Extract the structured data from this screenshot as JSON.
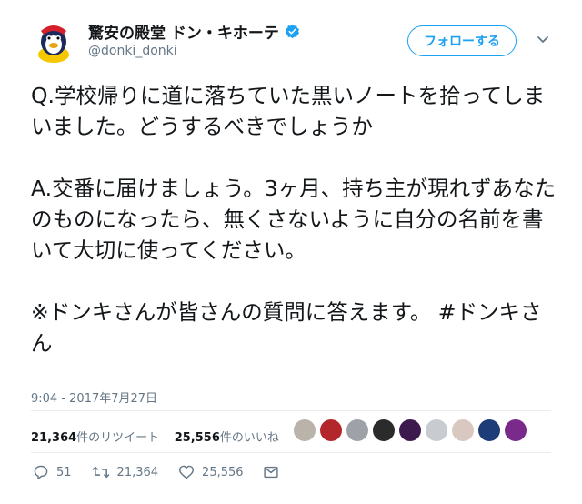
{
  "profile": {
    "display_name": "驚安の殿堂 ドン・キホーテ",
    "handle": "@donki_donki"
  },
  "follow_button": {
    "label": "フォローする"
  },
  "tweet": {
    "text": "Q.学校帰りに道に落ちていた黒いノートを拾ってしまいました。どうするべきでしょうか\n\nA.交番に届けましょう。3ヶ月、持ち主が現れずあなたのものになったら、無くさないように自分の名前を書いて大切に使ってください。\n\n※ドンキさんが皆さんの質問に答えます。 #ドンキさん",
    "timestamp": "9:04 - 2017年7月27日"
  },
  "stats": {
    "retweets_count": "21,364",
    "retweets_label": "件のリツイート",
    "likes_count": "25,556",
    "likes_label": "件のいいね"
  },
  "likers": [
    {
      "icon": "liker-avatar-1",
      "color": "#b9b3aa"
    },
    {
      "icon": "liker-avatar-2",
      "color": "#b3262c"
    },
    {
      "icon": "liker-avatar-3",
      "color": "#9ea2a8"
    },
    {
      "icon": "liker-avatar-4",
      "color": "#2b2b2b"
    },
    {
      "icon": "liker-avatar-5",
      "color": "#3c1a4d"
    },
    {
      "icon": "liker-avatar-6",
      "color": "#c8ccd0"
    },
    {
      "icon": "liker-avatar-7",
      "color": "#d8c8c0"
    },
    {
      "icon": "liker-avatar-8",
      "color": "#1e3c78"
    },
    {
      "icon": "liker-avatar-9",
      "color": "#7a2a8a"
    }
  ],
  "actions": {
    "reply_count": "51",
    "retweet_count": "21,364",
    "like_count": "25,556"
  },
  "colors": {
    "accent": "#1da1f2",
    "text": "#14171a",
    "secondary": "#657786",
    "divider": "#e6ecf0"
  }
}
